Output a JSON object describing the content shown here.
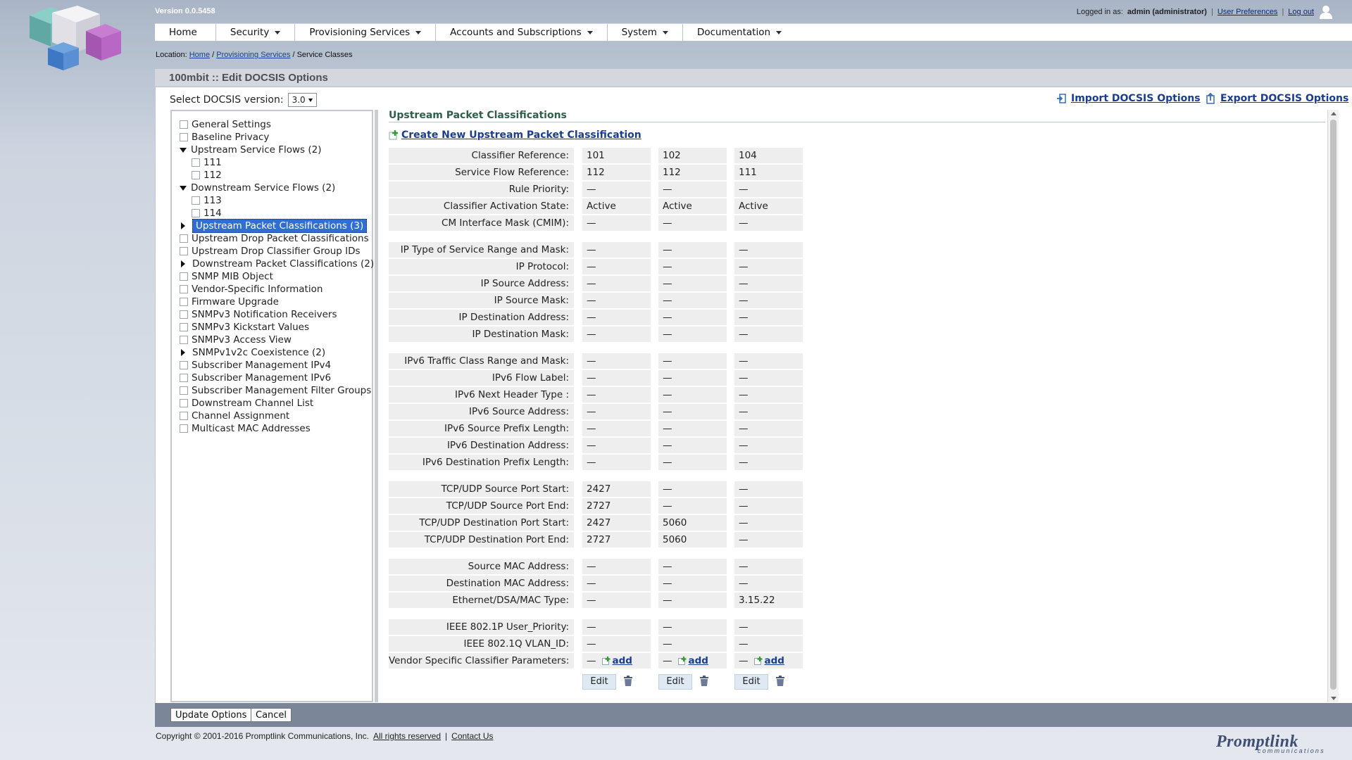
{
  "header": {
    "version": "Version 0.0.5458",
    "logged_in_prefix": "Logged in as:",
    "logged_in_user": "admin (administrator)",
    "user_preferences": "User Preferences",
    "logout": "Log out"
  },
  "nav": {
    "home": "Home",
    "security": "Security",
    "provisioning": "Provisioning Services",
    "accounts": "Accounts and Subscriptions",
    "system": "System",
    "documentation": "Documentation"
  },
  "location": {
    "prefix": "Location:",
    "home": "Home",
    "provisioning": "Provisioning Services",
    "current": "/ Service Classes"
  },
  "panel_title": "100mbit :: Edit DOCSIS Options",
  "docsis": {
    "label": "Select DOCSIS version:",
    "value": "3.0"
  },
  "actions": {
    "import": "Import DOCSIS Options",
    "export": "Export DOCSIS Options"
  },
  "tree": [
    "General Settings",
    "Baseline Privacy",
    "Upstream Service Flows (2)",
    "111",
    "112",
    "Downstream Service Flows (2)",
    "113",
    "114",
    "Upstream Packet Classifications (3)",
    "Upstream Drop Packet Classifications",
    "Upstream Drop Classifier Group IDs",
    "Downstream Packet Classifications (2)",
    "SNMP MIB Object",
    "Vendor-Specific Information",
    "Firmware Upgrade",
    "SNMPv3 Notification Receivers",
    "SNMPv3 Kickstart Values",
    "SNMPv3 Access View",
    "SNMPv1v2c Coexistence (2)",
    "Subscriber Management IPv4",
    "Subscriber Management IPv6",
    "Subscriber Management Filter Groups",
    "Downstream Channel List",
    "Channel Assignment",
    "Multicast MAC Addresses"
  ],
  "content": {
    "title": "Upstream Packet Classifications",
    "create": "Create New Upstream Packet Classification",
    "add_label": "add",
    "edit_label": "Edit",
    "rows": [
      {
        "label": "Classifier Reference:",
        "v": [
          "101",
          "102",
          "104"
        ]
      },
      {
        "label": "Service Flow Reference:",
        "v": [
          "112",
          "112",
          "111"
        ]
      },
      {
        "label": "Rule Priority:",
        "v": [
          "—",
          "—",
          "—"
        ]
      },
      {
        "label": "Classifier Activation State:",
        "v": [
          "Active",
          "Active",
          "Active"
        ]
      },
      {
        "label": "CM Interface Mask (CMIM):",
        "v": [
          "—",
          "—",
          "—"
        ]
      },
      {
        "label": "IP Type of Service Range and Mask:",
        "v": [
          "—",
          "—",
          "—"
        ]
      },
      {
        "label": "IP Protocol:",
        "v": [
          "—",
          "—",
          "—"
        ]
      },
      {
        "label": "IP Source Address:",
        "v": [
          "—",
          "—",
          "—"
        ]
      },
      {
        "label": "IP Source Mask:",
        "v": [
          "—",
          "—",
          "—"
        ]
      },
      {
        "label": "IP Destination Address:",
        "v": [
          "—",
          "—",
          "—"
        ]
      },
      {
        "label": "IP Destination Mask:",
        "v": [
          "—",
          "—",
          "—"
        ]
      },
      {
        "label": "IPv6 Traffic Class Range and Mask:",
        "v": [
          "—",
          "—",
          "—"
        ]
      },
      {
        "label": "IPv6 Flow Label:",
        "v": [
          "—",
          "—",
          "—"
        ]
      },
      {
        "label": "IPv6 Next Header Type :",
        "v": [
          "—",
          "—",
          "—"
        ]
      },
      {
        "label": "IPv6 Source Address:",
        "v": [
          "—",
          "—",
          "—"
        ]
      },
      {
        "label": "IPv6 Source Prefix Length:",
        "v": [
          "—",
          "—",
          "—"
        ]
      },
      {
        "label": "IPv6 Destination Address:",
        "v": [
          "—",
          "—",
          "—"
        ]
      },
      {
        "label": "IPv6 Destination Prefix Length:",
        "v": [
          "—",
          "—",
          "—"
        ]
      },
      {
        "label": "TCP/UDP Source Port Start:",
        "v": [
          "2427",
          "—",
          "—"
        ]
      },
      {
        "label": "TCP/UDP Source Port End:",
        "v": [
          "2727",
          "—",
          "—"
        ]
      },
      {
        "label": "TCP/UDP Destination Port Start:",
        "v": [
          "2427",
          "5060",
          "—"
        ]
      },
      {
        "label": "TCP/UDP Destination Port End:",
        "v": [
          "2727",
          "5060",
          "—"
        ]
      },
      {
        "label": "Source MAC Address:",
        "v": [
          "—",
          "—",
          "—"
        ]
      },
      {
        "label": "Destination MAC Address:",
        "v": [
          "—",
          "—",
          "—"
        ]
      },
      {
        "label": "Ethernet/DSA/MAC Type:",
        "v": [
          "—",
          "—",
          "3.15.22"
        ]
      },
      {
        "label": "IEEE 802.1P User_Priority:",
        "v": [
          "—",
          "—",
          "—"
        ]
      },
      {
        "label": "IEEE 802.1Q VLAN_ID:",
        "v": [
          "—",
          "—",
          "—"
        ]
      },
      {
        "label": "Vendor Specific Classifier Parameters:",
        "v": [
          "—",
          "—",
          "—"
        ]
      }
    ]
  },
  "buttons": {
    "update": "Update Options",
    "cancel": "Cancel"
  },
  "footer": {
    "copyright": "Copyright © 2001-2016 Promptlink Communications, Inc.",
    "rights": "All rights reserved",
    "sep": "|",
    "contact": "Contact Us",
    "brand": "Promptlink",
    "brand_sub": "communications"
  }
}
